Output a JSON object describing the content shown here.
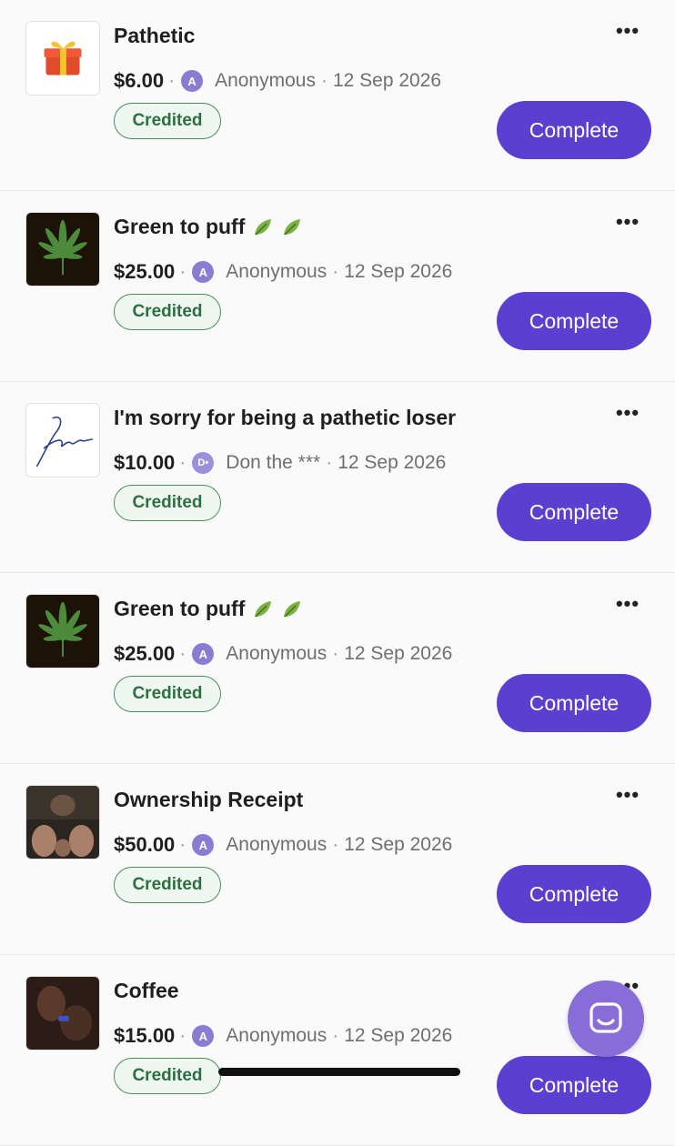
{
  "transactions": [
    {
      "title": "Pathetic",
      "emoji": "",
      "amount": "$6.00",
      "avatar": "A",
      "sender": "Anonymous",
      "date": "12 Sep 2026",
      "status": "Credited",
      "action": "Complete",
      "thumb": "gift"
    },
    {
      "title": "Green to puff",
      "emoji": "leaves",
      "amount": "$25.00",
      "avatar": "A",
      "sender": "Anonymous",
      "date": "12 Sep 2026",
      "status": "Credited",
      "action": "Complete",
      "thumb": "leaf"
    },
    {
      "title": "I'm sorry for being a pathetic loser",
      "emoji": "",
      "amount": "$10.00",
      "avatar": "D•",
      "sender": "Don the ***",
      "date": "12 Sep 2026",
      "status": "Credited",
      "action": "Complete",
      "thumb": "signature"
    },
    {
      "title": "Green to puff",
      "emoji": "leaves",
      "amount": "$25.00",
      "avatar": "A",
      "sender": "Anonymous",
      "date": "12 Sep 2026",
      "status": "Credited",
      "action": "Complete",
      "thumb": "leaf"
    },
    {
      "title": "Ownership Receipt",
      "emoji": "",
      "amount": "$50.00",
      "avatar": "A",
      "sender": "Anonymous",
      "date": "12 Sep 2026",
      "status": "Credited",
      "action": "Complete",
      "thumb": "photo"
    },
    {
      "title": "Coffee",
      "emoji": "",
      "amount": "$15.00",
      "avatar": "A",
      "sender": "Anonymous",
      "date": "12 Sep 2026",
      "status": "Credited",
      "action": "Complete",
      "thumb": "dark-photo"
    }
  ],
  "more_label": "•••",
  "colors": {
    "accent": "#5a3fd0",
    "credited": "#2f6e43",
    "fab": "#8a6cd8"
  },
  "icons": {
    "more": "more-dots-icon",
    "chat": "chat-bubble-icon"
  }
}
